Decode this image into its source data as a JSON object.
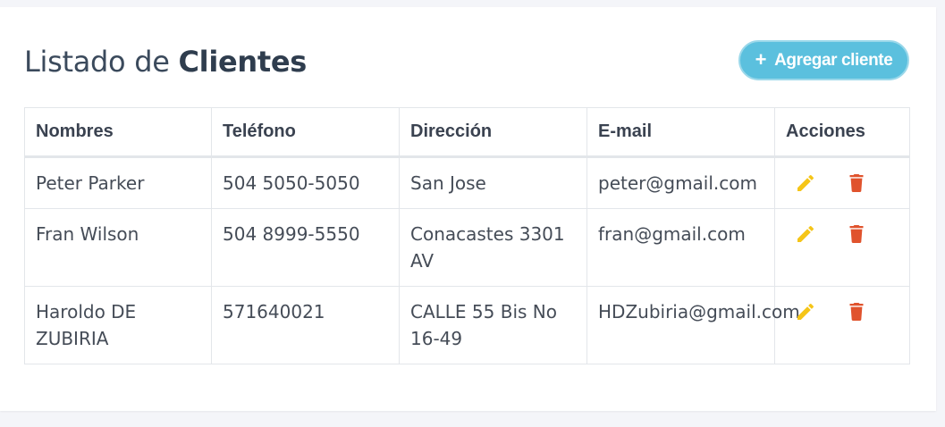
{
  "header": {
    "title_prefix": "Listado de ",
    "title_bold": "Clientes",
    "add_button_label": "Agregar cliente",
    "add_button_icon": "plus-icon"
  },
  "colors": {
    "button": "#5bc0de",
    "edit_icon": "#f5c518",
    "delete_icon": "#e0532d"
  },
  "table": {
    "columns": [
      "Nombres",
      "Teléfono",
      "Dirección",
      "E-mail",
      "Acciones"
    ],
    "rows": [
      {
        "nombres": "Peter Parker",
        "telefono": "504 5050-5050",
        "direccion": "San Jose",
        "email": "peter@gmail.com"
      },
      {
        "nombres": "Fran Wilson",
        "telefono": "504 8999-5550",
        "direccion": "Conacastes 3301 AV",
        "email": "fran@gmail.com"
      },
      {
        "nombres": "Haroldo DE ZUBIRIA",
        "telefono": "571640021",
        "direccion": "CALLE 55 Bis No 16-49",
        "email": "HDZubiria@gmail.com"
      }
    ],
    "row_actions": [
      "pencil-icon",
      "trash-icon"
    ]
  }
}
